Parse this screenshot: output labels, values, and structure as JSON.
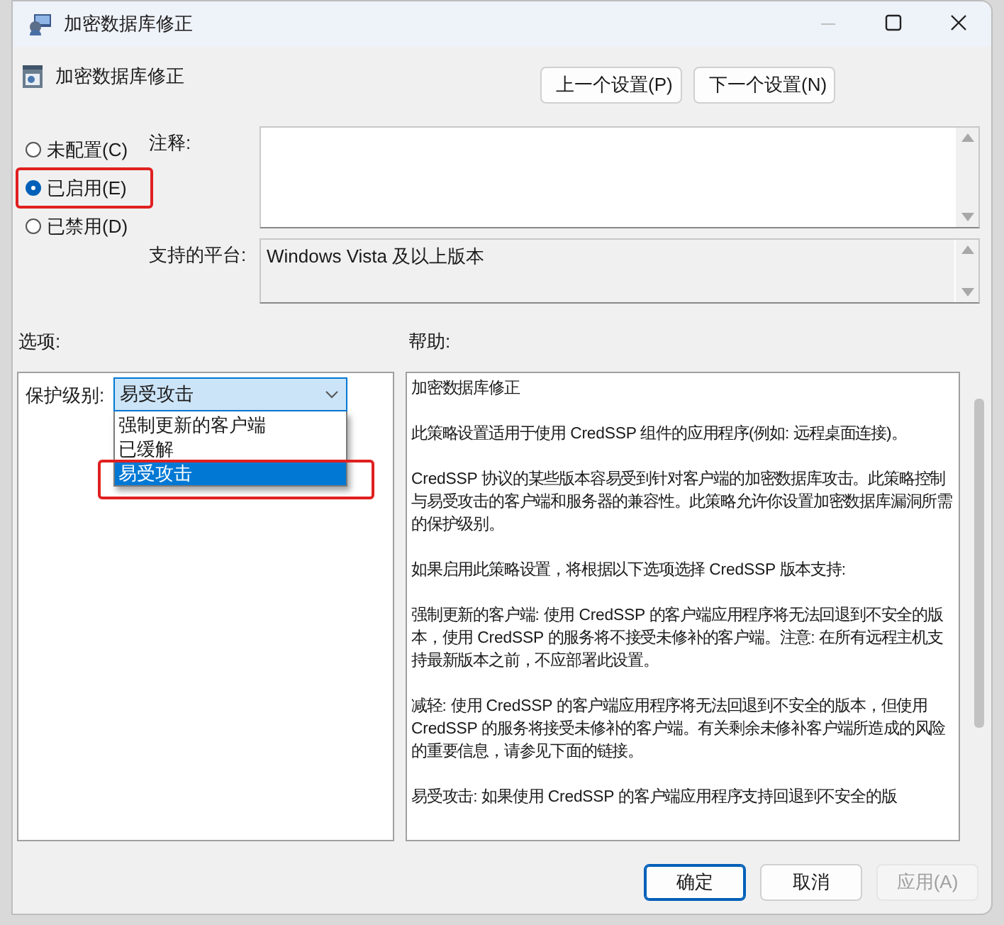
{
  "window": {
    "title": "加密数据库修正"
  },
  "header": {
    "title": "加密数据库修正"
  },
  "nav_buttons": [
    {
      "label": "上一个设置(P)"
    },
    {
      "label": "下一个设置(N)"
    }
  ],
  "state_options": [
    {
      "label": "未配置(C)",
      "selected": false,
      "highlighted": false
    },
    {
      "label": "已启用(E)",
      "selected": true,
      "highlighted": true
    },
    {
      "label": "已禁用(D)",
      "selected": false,
      "highlighted": false
    }
  ],
  "comment": {
    "label": "注释:"
  },
  "platform": {
    "label": "支持的平台:",
    "value": "Windows Vista 及以上版本"
  },
  "options": {
    "heading": "选项:",
    "protection": {
      "label": "保护级别:",
      "value": "易受攻击",
      "expanded": true,
      "items": [
        {
          "label": "强制更新的客户端",
          "selected": false,
          "highlighted": false
        },
        {
          "label": "已缓解",
          "selected": false,
          "highlighted": false
        },
        {
          "label": "易受攻击",
          "selected": true,
          "highlighted": true
        }
      ]
    }
  },
  "help": {
    "heading": "帮助:",
    "paragraphs": [
      "加密数据库修正",
      "此策略设置适用于使用 CredSSP 组件的应用程序(例如: 远程桌面连接)。",
      "CredSSP 协议的某些版本容易受到针对客户端的加密数据库攻击。此策略控制与易受攻击的客户端和服务器的兼容性。此策略允许你设置加密数据库漏洞所需的保护级别。",
      "如果启用此策略设置，将根据以下选项选择 CredSSP 版本支持:",
      "强制更新的客户端: 使用 CredSSP 的客户端应用程序将无法回退到不安全的版本，使用 CredSSP 的服务将不接受未修补的客户端。注意: 在所有远程主机支持最新版本之前，不应部署此设置。",
      "减轻: 使用 CredSSP 的客户端应用程序将无法回退到不安全的版本，但使用 CredSSP 的服务将接受未修补的客户端。有关剩余未修补客户端所造成的风险的重要信息，请参见下面的链接。",
      "易受攻击: 如果使用 CredSSP 的客户端应用程序支持回退到不安全的版"
    ]
  },
  "buttons": [
    {
      "label": "确定",
      "default": true,
      "disabled": false
    },
    {
      "label": "取消",
      "default": false,
      "disabled": false
    },
    {
      "label": "应用(A)",
      "default": false,
      "disabled": true
    }
  ]
}
